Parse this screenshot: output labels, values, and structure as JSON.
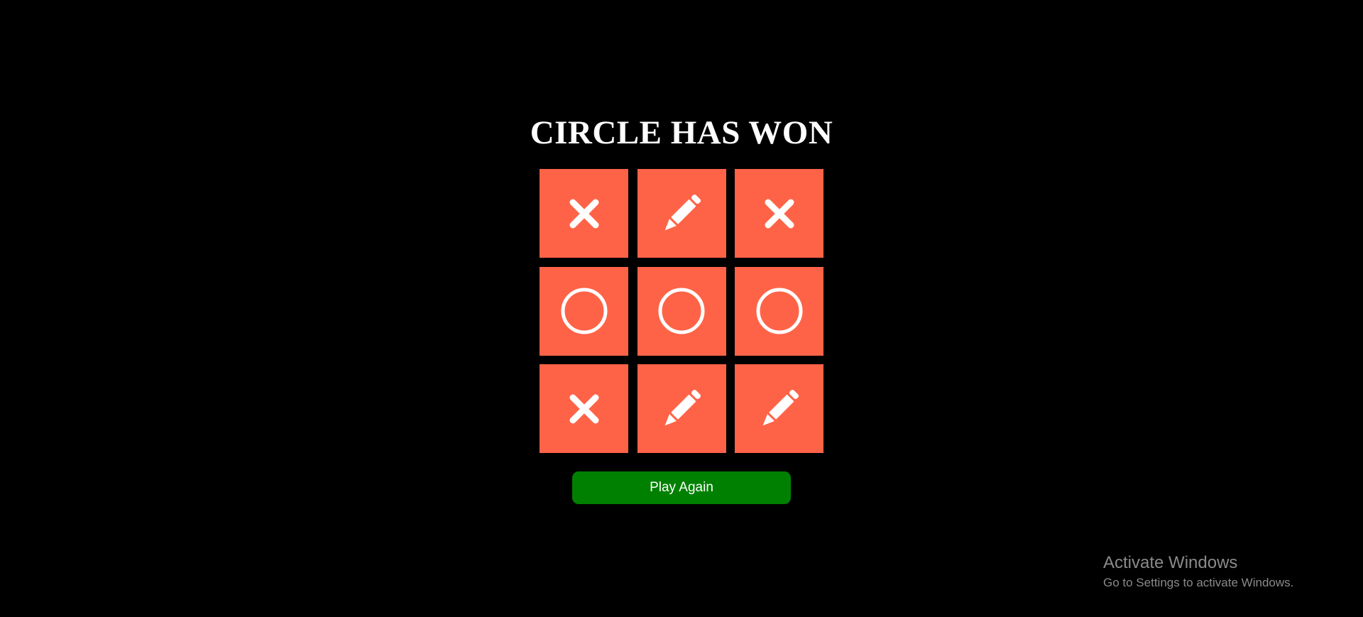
{
  "game": {
    "status_text": "CIRCLE HAS WON",
    "board": [
      {
        "mark": "x",
        "icon": "x-mark-icon"
      },
      {
        "mark": "empty",
        "icon": "pencil-icon"
      },
      {
        "mark": "x",
        "icon": "x-mark-icon"
      },
      {
        "mark": "o",
        "icon": "circle-icon"
      },
      {
        "mark": "o",
        "icon": "circle-icon"
      },
      {
        "mark": "o",
        "icon": "circle-icon"
      },
      {
        "mark": "x",
        "icon": "x-mark-icon"
      },
      {
        "mark": "empty",
        "icon": "pencil-icon"
      },
      {
        "mark": "empty",
        "icon": "pencil-icon"
      }
    ],
    "play_again_label": "Play Again"
  },
  "watermark": {
    "title": "Activate Windows",
    "subtitle": "Go to Settings to activate Windows."
  },
  "colors": {
    "background": "#000000",
    "cell": "#ff6347",
    "icon": "#ffffff",
    "button": "#008000",
    "button_text": "#ffffff",
    "watermark_text": "#8a8a8a"
  }
}
